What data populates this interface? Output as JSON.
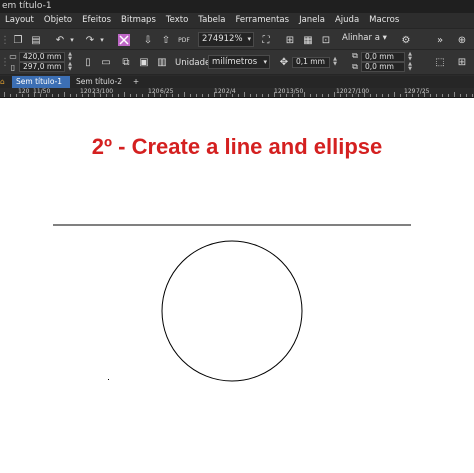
{
  "window": {
    "title": "em título-1"
  },
  "menu": [
    "Layout",
    "Objeto",
    "Efeitos",
    "Bitmaps",
    "Texto",
    "Tabela",
    "Ferramentas",
    "Janela",
    "Ajuda",
    "Macros"
  ],
  "toolbar": {
    "zoom": "274912%",
    "align_label": "Alinhar a"
  },
  "property_bar": {
    "width": "420,0 mm",
    "height": "297,0 mm",
    "units_label": "Unidades:",
    "units_value": "milímetros",
    "nudge": "0,1 mm",
    "dup_x": "0,0 mm",
    "dup_y": "0,0 mm"
  },
  "tabs": [
    "Sem título-1",
    "Sem título-2"
  ],
  "ruler_labels": [
    "120",
    "11/50",
    "120",
    "23/100",
    "120",
    "6/25",
    "120",
    "2/4",
    "120",
    "13/50",
    "120",
    "27/100",
    "129",
    "7/25"
  ],
  "canvas": {
    "headline": "2º - Create a line and ellipse"
  }
}
